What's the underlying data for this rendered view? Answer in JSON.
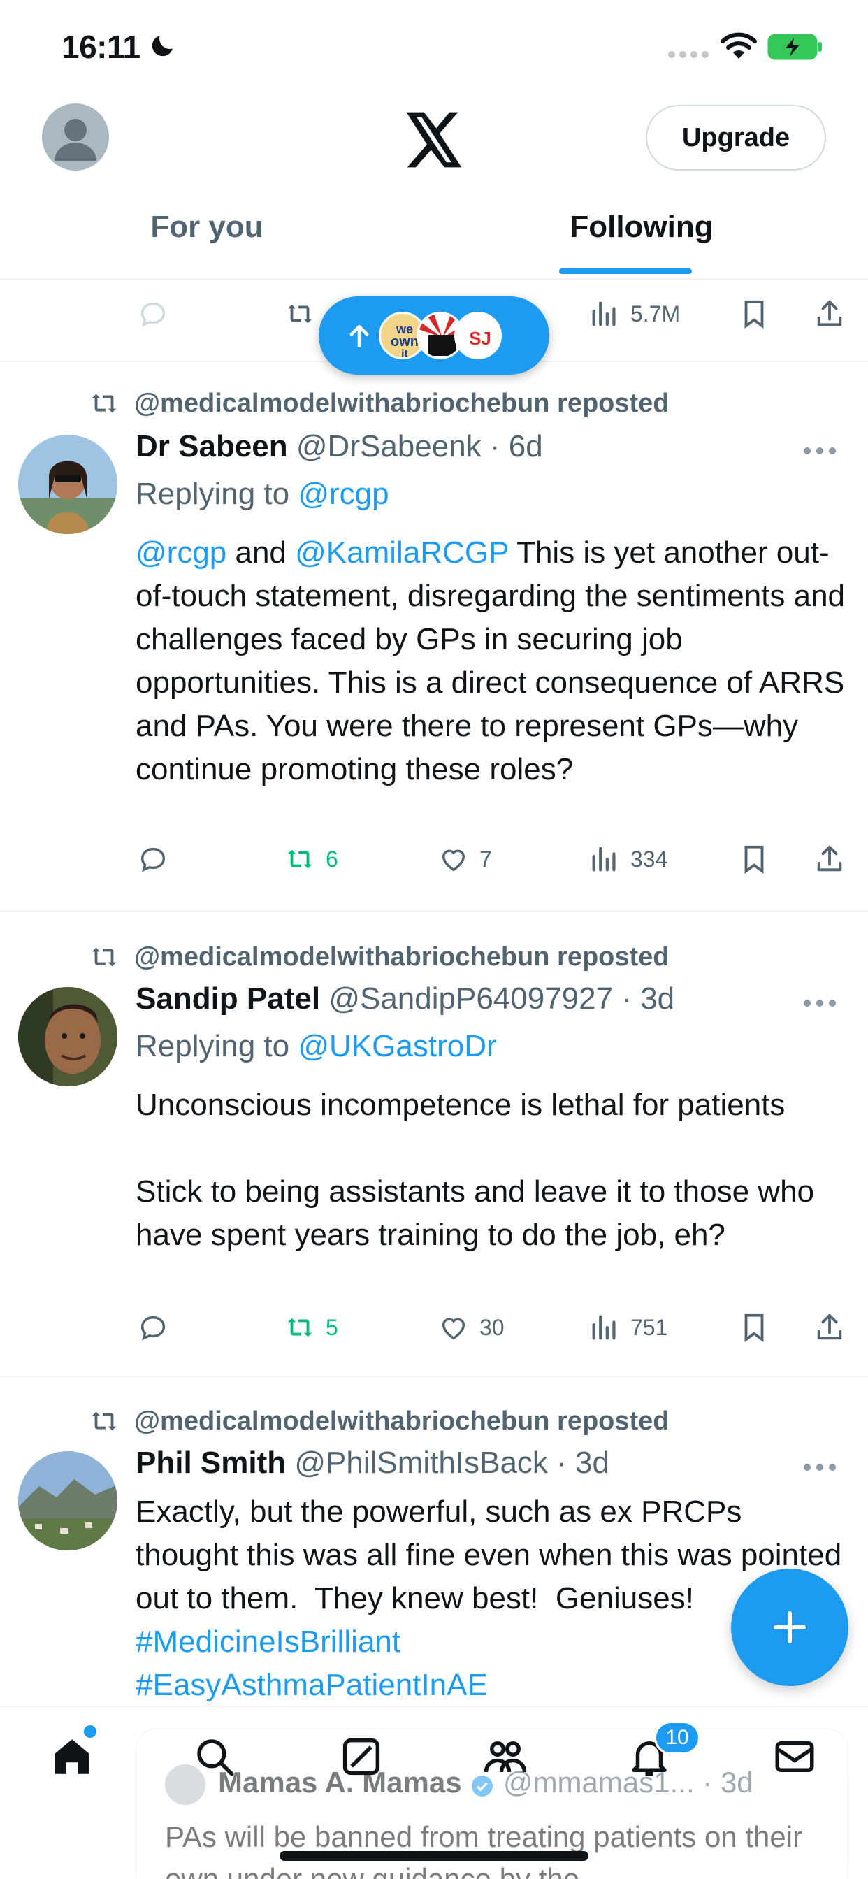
{
  "status": {
    "time": "16:11"
  },
  "header": {
    "upgrade_label": "Upgrade",
    "tabs": [
      {
        "label": "For you"
      },
      {
        "label": "Following"
      }
    ]
  },
  "stub": {
    "views": "5.7M"
  },
  "tweets": [
    {
      "reposted_by": "@medicalmodelwithabriochebun reposted",
      "name": "Dr Sabeen",
      "handle": "@DrSabeenk · 6d",
      "replying_prefix": "Replying to ",
      "replying_to": "@rcgp",
      "mention1": "@rcgp",
      "mid": " and ",
      "mention2": "@KamilaRCGP",
      "text": " This is yet another out-of-touch statement, disregarding the sentiments and challenges faced by GPs in securing job opportunities. This is a direct consequence of ARRS and PAs. You were there to represent GPs—why continue promoting these roles?",
      "retweets": "6",
      "likes": "7",
      "views": "334"
    },
    {
      "reposted_by": "@medicalmodelwithabriochebun reposted",
      "name": "Sandip Patel",
      "handle": "@SandipP64097927 · 3d",
      "replying_prefix": "Replying to ",
      "replying_to": "@UKGastroDr",
      "text": "Unconscious incompetence is lethal for patients\n\nStick to being assistants and leave it to those who have spent years training to do the job, eh?",
      "retweets": "5",
      "likes": "30",
      "views": "751"
    },
    {
      "reposted_by": "@medicalmodelwithabriochebun reposted",
      "name": "Phil Smith",
      "handle": "@PhilSmithIsBack · 3d",
      "text": "Exactly, but the powerful, such as ex PRCPs thought this was all fine even when this was pointed out to them.  They knew best!  Geniuses! ",
      "hashtag1": "#MedicineIsBrilliant",
      "hashtag2": "#EasyAsthmaPatientInAE"
    }
  ],
  "ghost": {
    "name": "Mamas A. Mamas",
    "handle": "@mmamas1... · 3d",
    "text": "PAs will be banned from treating patients on their own under new guidance by the"
  },
  "nav": {
    "notification_count": "10"
  },
  "colors": {
    "accent": "#1d9bf0",
    "retweet": "#00ba7c",
    "muted": "#536471"
  }
}
